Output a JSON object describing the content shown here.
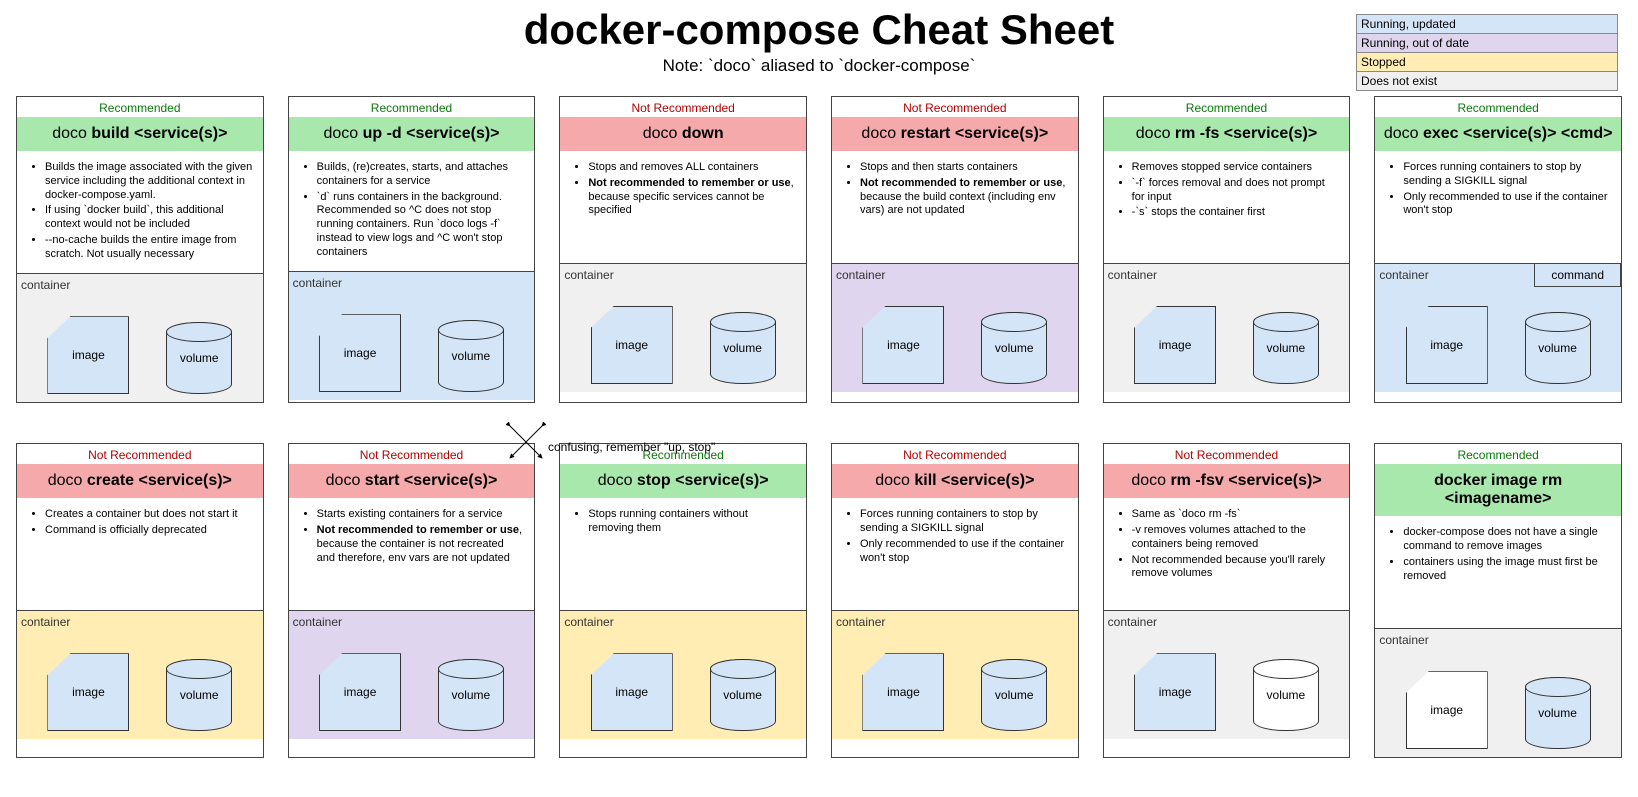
{
  "title": "docker-compose Cheat Sheet",
  "subtitle": "Note: `doco` aliased to `docker-compose`",
  "legend": [
    {
      "label": "Running, updated",
      "color": "#d5e5f8"
    },
    {
      "label": "Running, out of date",
      "color": "#e0d5ee"
    },
    {
      "label": "Stopped",
      "color": "#ffedb3"
    },
    {
      "label": "Does not exist",
      "color": "#f0f0f0"
    }
  ],
  "crossNote": "confusing, remember \"up, stop\"",
  "shapeLabels": {
    "image": "image",
    "volume": "volume",
    "container": "container",
    "command": "command"
  },
  "shapeStyles": {
    "image": {
      "blue": "Image is built or updated by this command",
      "white": "Image is unchanged by this command"
    },
    "volume": {
      "blue": "Volume is present / untouched",
      "white": "Volume is removed by this command"
    }
  },
  "cards": [
    {
      "rec": "Recommended",
      "recGood": true,
      "cmd": {
        "prefix": "doco ",
        "bold": "build <service(s)>"
      },
      "bullets": [
        {
          "text": "Builds the image associated with the given service including the additional context in docker-compose.yaml."
        },
        {
          "text": "If using `docker build`, this additional context would not be included"
        },
        {
          "text": "--no-cache builds the entire image from scratch. Not usually necessary"
        }
      ],
      "state": "grey",
      "imageStyle": "blue",
      "volumeStyle": "blue",
      "showCommand": false
    },
    {
      "rec": "Recommended",
      "recGood": true,
      "cmd": {
        "prefix": "doco ",
        "bold": "up -d <service(s)>"
      },
      "bullets": [
        {
          "text": "Builds, (re)creates, starts, and attaches containers for a service"
        },
        {
          "text": "`d` runs containers in the background. Recommended so ^C does not stop running containers. Run `doco logs -f` instead to view logs and ^C won't stop containers"
        }
      ],
      "state": "blue",
      "imageStyle": "blue",
      "volumeStyle": "blue",
      "showCommand": false
    },
    {
      "rec": "Not Recommended",
      "recGood": false,
      "cmd": {
        "prefix": "doco ",
        "bold": "down"
      },
      "bullets": [
        {
          "text": "Stops and removes ALL containers"
        },
        {
          "bold": "Not recommended to remember or use",
          "rest": ", because specific services cannot be specified"
        }
      ],
      "state": "grey",
      "imageStyle": "blue",
      "volumeStyle": "blue",
      "showCommand": false
    },
    {
      "rec": "Not Recommended",
      "recGood": false,
      "cmd": {
        "prefix": "doco ",
        "bold": "restart <service(s)>"
      },
      "bullets": [
        {
          "text": "Stops and then starts containers"
        },
        {
          "bold": "Not recommended to remember or use",
          "rest": ", because the build context (including env vars) are not updated"
        }
      ],
      "state": "purple",
      "imageStyle": "blue",
      "volumeStyle": "blue",
      "showCommand": false
    },
    {
      "rec": "Recommended",
      "recGood": true,
      "cmd": {
        "prefix": "doco ",
        "bold": "rm -fs <service(s)>"
      },
      "bullets": [
        {
          "text": "Removes stopped service containers"
        },
        {
          "text": "`-f` forces removal and does not prompt for input"
        },
        {
          "text": "-`s` stops the container first"
        }
      ],
      "state": "grey",
      "imageStyle": "blue",
      "volumeStyle": "blue",
      "showCommand": false
    },
    {
      "rec": "Recommended",
      "recGood": true,
      "cmd": {
        "prefix": "doco ",
        "bold": "exec <service(s)> <cmd>"
      },
      "bullets": [
        {
          "text": "Forces running containers to stop by sending a SIGKILL signal"
        },
        {
          "text": "Only recommended to use if the container won't stop"
        }
      ],
      "state": "blue",
      "imageStyle": "blue",
      "volumeStyle": "blue",
      "showCommand": true
    },
    {
      "rec": "Not Recommended",
      "recGood": false,
      "cmd": {
        "prefix": "doco ",
        "bold": "create <service(s)>"
      },
      "bullets": [
        {
          "text": "Creates a container but does not start it"
        },
        {
          "text": "Command is officially deprecated"
        }
      ],
      "state": "yellow",
      "imageStyle": "blue",
      "volumeStyle": "blue",
      "showCommand": false
    },
    {
      "rec": "Not Recommended",
      "recGood": false,
      "cmd": {
        "prefix": "doco ",
        "bold": "start <service(s)>"
      },
      "bullets": [
        {
          "text": "Starts existing containers for a service"
        },
        {
          "bold": "Not recommended to remember or use",
          "rest": ", because the container is not recreated and therefore, env vars are not updated"
        }
      ],
      "state": "purple",
      "imageStyle": "blue",
      "volumeStyle": "blue",
      "showCommand": false
    },
    {
      "rec": "Recommended",
      "recGood": true,
      "cmd": {
        "prefix": "doco ",
        "bold": "stop <service(s)>"
      },
      "bullets": [
        {
          "text": "Stops running containers without removing them"
        }
      ],
      "state": "yellow",
      "imageStyle": "blue",
      "volumeStyle": "blue",
      "showCommand": false
    },
    {
      "rec": "Not Recommended",
      "recGood": false,
      "cmd": {
        "prefix": "doco ",
        "bold": "kill <service(s)>"
      },
      "bullets": [
        {
          "text": "Forces running containers to stop by sending a SIGKILL signal"
        },
        {
          "text": "Only recommended to use if the container won't stop"
        }
      ],
      "state": "yellow",
      "imageStyle": "blue",
      "volumeStyle": "blue",
      "showCommand": false
    },
    {
      "rec": "Not Recommended",
      "recGood": false,
      "cmd": {
        "prefix": "doco ",
        "bold": "rm -fsv <service(s)>"
      },
      "bullets": [
        {
          "text": "Same as `doco rm -fs`"
        },
        {
          "text": "-v removes volumes attached to the containers being removed"
        },
        {
          "text": "Not recommended because you'll rarely remove volumes"
        }
      ],
      "state": "grey",
      "imageStyle": "blue",
      "volumeStyle": "white",
      "showCommand": false
    },
    {
      "rec": "Recommended",
      "recGood": true,
      "cmd": {
        "prefix": "",
        "bold": "docker image rm <imagename>"
      },
      "bullets": [
        {
          "text": "docker-compose does not have a single command to remove images"
        },
        {
          "text": "containers using the image must first be removed"
        }
      ],
      "state": "grey",
      "imageStyle": "white",
      "volumeStyle": "blue",
      "showCommand": false
    }
  ]
}
